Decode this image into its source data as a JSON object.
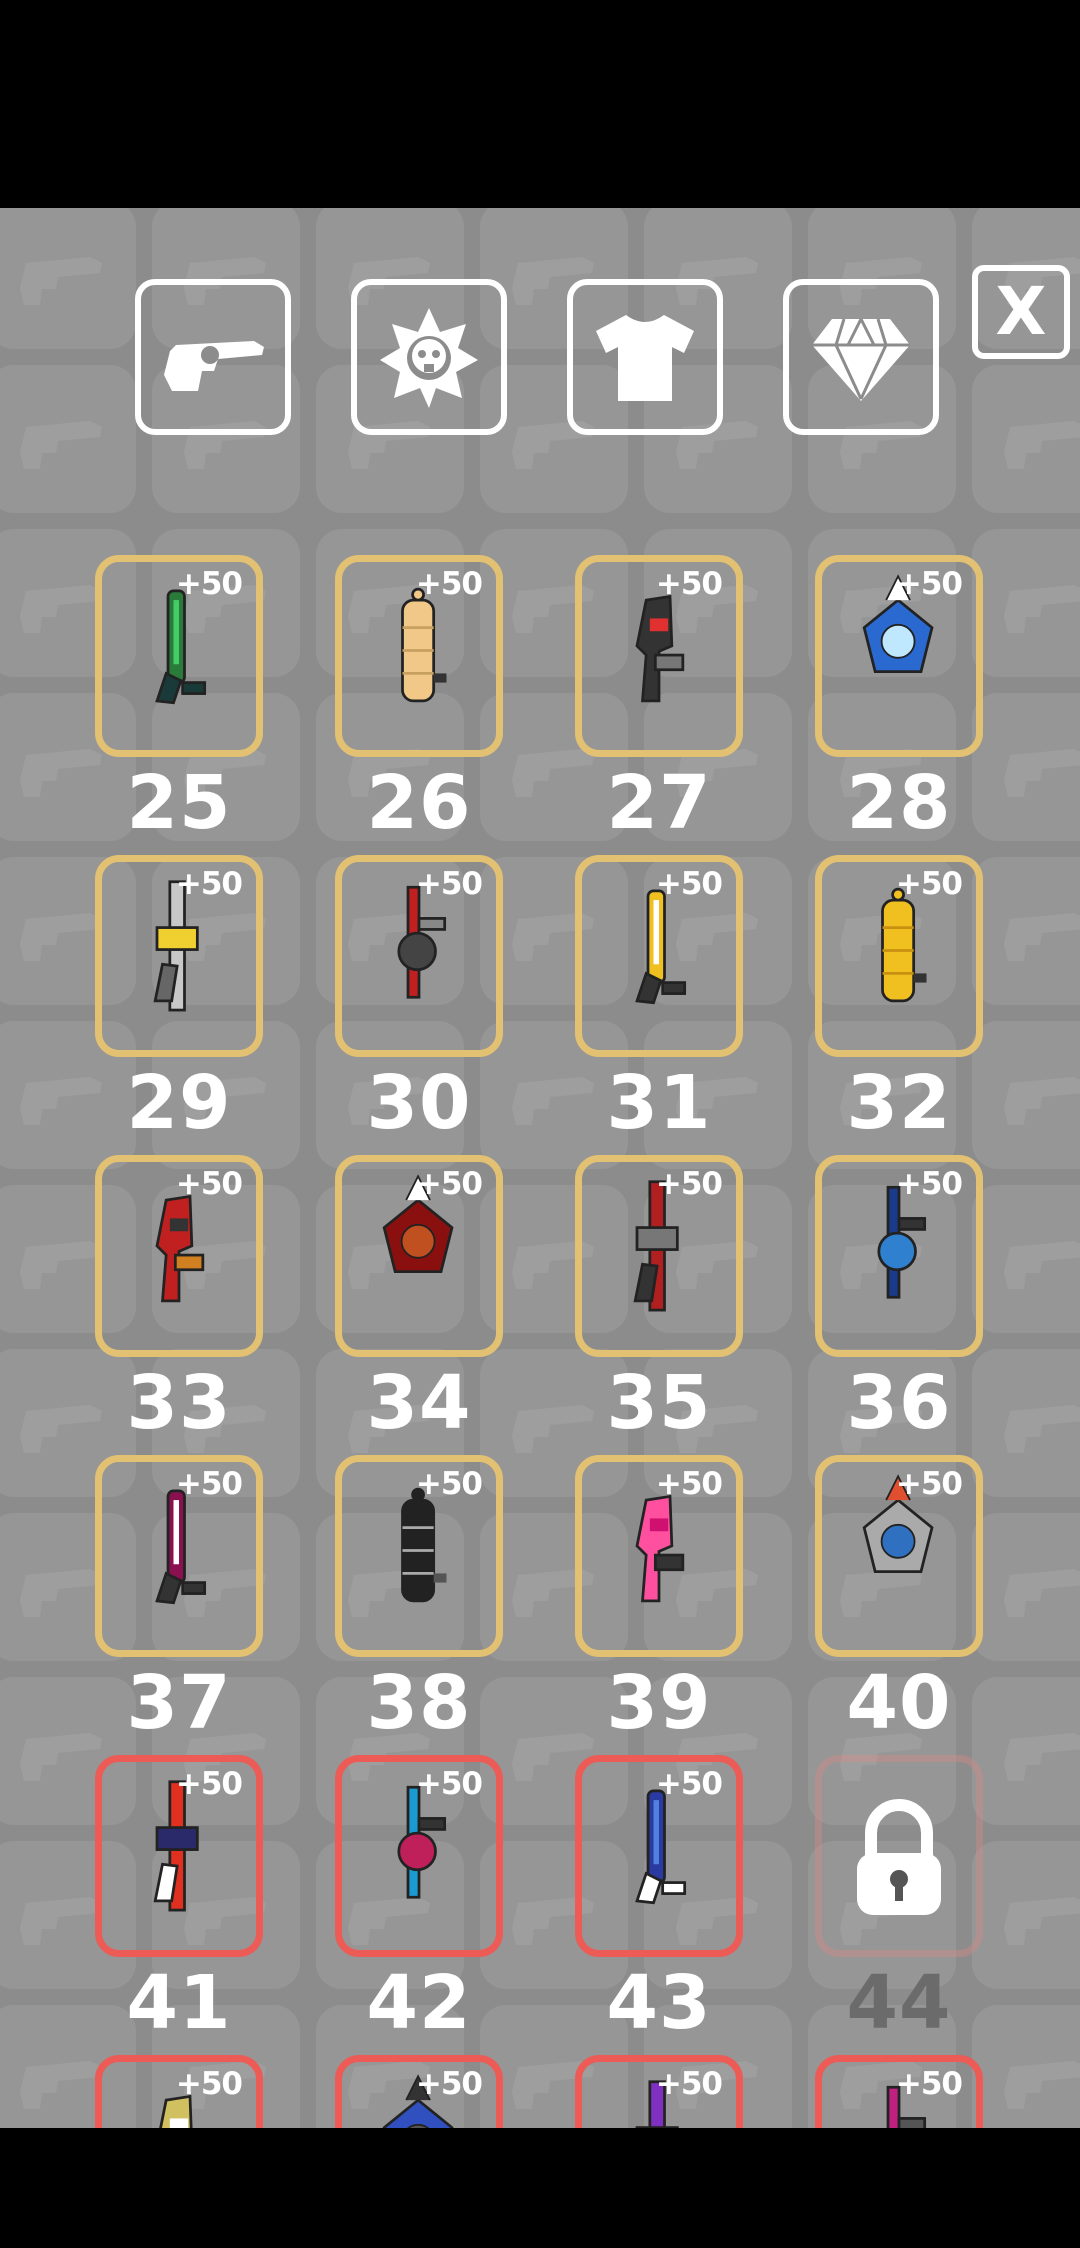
{
  "tabs": [
    {
      "name": "weapons-tab",
      "icon": "revolver-icon"
    },
    {
      "name": "skull-tab",
      "icon": "skull-star-icon"
    },
    {
      "name": "shirt-tab",
      "icon": "shirt-icon"
    },
    {
      "name": "diamond-tab",
      "icon": "diamond-icon"
    }
  ],
  "close_label": "X",
  "bonus_label": "+50",
  "slots": [
    {
      "number": "25",
      "tier": "gold",
      "locked": false,
      "palette": [
        "#2a7a3a",
        "#44cc66",
        "#1a3a3a"
      ]
    },
    {
      "number": "26",
      "tier": "gold",
      "locked": false,
      "palette": [
        "#f2c888",
        "#c8a060",
        "#333"
      ]
    },
    {
      "number": "27",
      "tier": "gold",
      "locked": false,
      "palette": [
        "#e03030",
        "#333333",
        "#777777"
      ]
    },
    {
      "number": "28",
      "tier": "gold",
      "locked": false,
      "palette": [
        "#2a6ad0",
        "#bfe8ff",
        "#ffffff"
      ]
    },
    {
      "number": "29",
      "tier": "gold",
      "locked": false,
      "palette": [
        "#c8c8c8",
        "#f0d030",
        "#666666"
      ]
    },
    {
      "number": "30",
      "tier": "gold",
      "locked": false,
      "palette": [
        "#c02020",
        "#444444",
        "#888888"
      ]
    },
    {
      "number": "31",
      "tier": "gold",
      "locked": false,
      "palette": [
        "#f0c020",
        "#ffffff",
        "#333333"
      ]
    },
    {
      "number": "32",
      "tier": "gold",
      "locked": false,
      "palette": [
        "#f0c020",
        "#c89010",
        "#333333"
      ]
    },
    {
      "number": "33",
      "tier": "gold",
      "locked": false,
      "palette": [
        "#333333",
        "#c02020",
        "#d08020"
      ]
    },
    {
      "number": "34",
      "tier": "gold",
      "locked": false,
      "palette": [
        "#8a1010",
        "#c05020",
        "#ffffff"
      ]
    },
    {
      "number": "35",
      "tier": "gold",
      "locked": false,
      "palette": [
        "#b02020",
        "#777777",
        "#333333"
      ]
    },
    {
      "number": "36",
      "tier": "gold",
      "locked": false,
      "palette": [
        "#1a3a8a",
        "#3080d0",
        "#333333"
      ]
    },
    {
      "number": "37",
      "tier": "gold",
      "locked": false,
      "palette": [
        "#8a1050",
        "#ffffff",
        "#333333"
      ]
    },
    {
      "number": "38",
      "tier": "gold",
      "locked": false,
      "palette": [
        "#222222",
        "#aaaaaa",
        "#555555"
      ]
    },
    {
      "number": "39",
      "tier": "gold",
      "locked": false,
      "palette": [
        "#d01070",
        "#ff50a0",
        "#333333"
      ]
    },
    {
      "number": "40",
      "tier": "gold",
      "locked": false,
      "palette": [
        "#aaaaaa",
        "#3070c0",
        "#e05030"
      ]
    },
    {
      "number": "41",
      "tier": "red",
      "locked": false,
      "palette": [
        "#e03020",
        "#2a2a6a",
        "#ffffff"
      ]
    },
    {
      "number": "42",
      "tier": "red",
      "locked": false,
      "palette": [
        "#1a9ad0",
        "#c0205a",
        "#333333"
      ]
    },
    {
      "number": "43",
      "tier": "red",
      "locked": false,
      "palette": [
        "#2a3aa0",
        "#5080e0",
        "#ffffff"
      ]
    },
    {
      "number": "44",
      "tier": "red",
      "locked": true,
      "palette": [
        "#333333",
        "#555555",
        "#ffffff"
      ]
    },
    {
      "number": "",
      "tier": "red",
      "locked": false,
      "palette": [
        "#ffffff",
        "#d0c060",
        "#333333"
      ]
    },
    {
      "number": "",
      "tier": "red",
      "locked": false,
      "palette": [
        "#3050c0",
        "#555555",
        "#333333"
      ]
    },
    {
      "number": "",
      "tier": "red",
      "locked": false,
      "palette": [
        "#8030c0",
        "#333333",
        "#555555"
      ]
    },
    {
      "number": "",
      "tier": "red",
      "locked": false,
      "palette": [
        "#c02080",
        "#333333",
        "#555555"
      ]
    }
  ],
  "colors": {
    "gold": "#e2c172",
    "red": "#ec5b55",
    "background": "#8c8c8c"
  }
}
